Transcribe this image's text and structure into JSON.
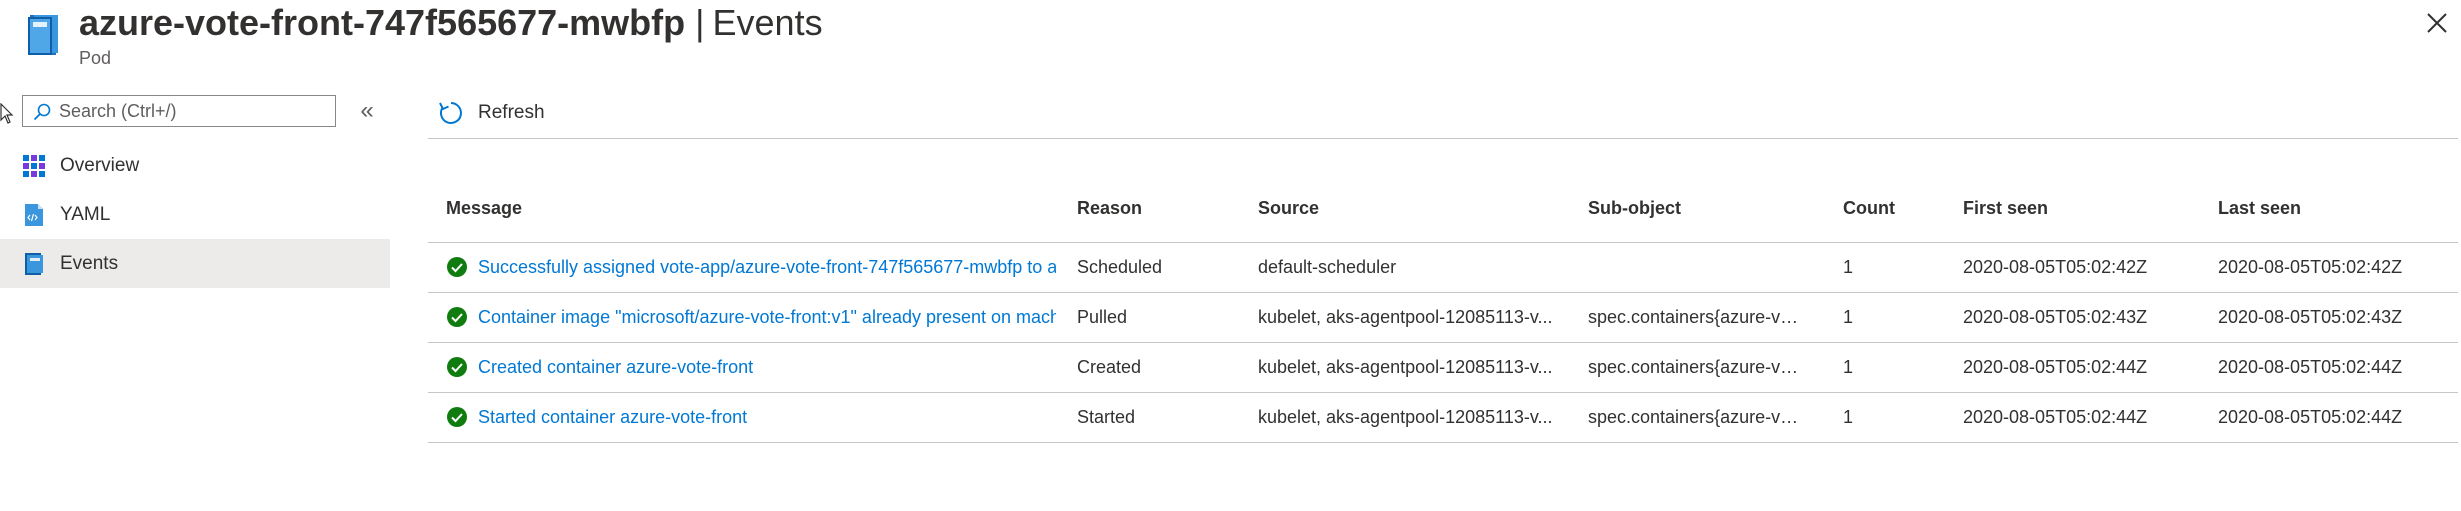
{
  "header": {
    "resource_name": "azure-vote-front-747f565677-mwbfp",
    "separator": "|",
    "section": "Events",
    "resource_type": "Pod"
  },
  "sidebar": {
    "search_placeholder": "Search (Ctrl+/)",
    "search_value": "",
    "collapse_glyph": "«",
    "items": [
      {
        "label": "Overview",
        "icon": "overview-grid-icon",
        "selected": false
      },
      {
        "label": "YAML",
        "icon": "yaml-file-icon",
        "selected": false
      },
      {
        "label": "Events",
        "icon": "events-icon",
        "selected": true
      }
    ]
  },
  "toolbar": {
    "refresh_label": "Refresh"
  },
  "events_table": {
    "columns": [
      "Message",
      "Reason",
      "Source",
      "Sub-object",
      "Count",
      "First seen",
      "Last seen"
    ],
    "rows": [
      {
        "message": "Successfully assigned vote-app/azure-vote-front-747f565677-mwbfp to a",
        "reason": "Scheduled",
        "source": "default-scheduler",
        "subobject": "",
        "count": "1",
        "first_seen": "2020-08-05T05:02:42Z",
        "last_seen": "2020-08-05T05:02:42Z"
      },
      {
        "message": "Container image \"microsoft/azure-vote-front:v1\" already present on mach",
        "reason": "Pulled",
        "source": "kubelet, aks-agentpool-12085113-v...",
        "subobject": "spec.containers{azure-vot...",
        "count": "1",
        "first_seen": "2020-08-05T05:02:43Z",
        "last_seen": "2020-08-05T05:02:43Z"
      },
      {
        "message": "Created container azure-vote-front",
        "reason": "Created",
        "source": "kubelet, aks-agentpool-12085113-v...",
        "subobject": "spec.containers{azure-vot...",
        "count": "1",
        "first_seen": "2020-08-05T05:02:44Z",
        "last_seen": "2020-08-05T05:02:44Z"
      },
      {
        "message": "Started container azure-vote-front",
        "reason": "Started",
        "source": "kubelet, aks-agentpool-12085113-v...",
        "subobject": "spec.containers{azure-vot...",
        "count": "1",
        "first_seen": "2020-08-05T05:02:44Z",
        "last_seen": "2020-08-05T05:02:44Z"
      }
    ]
  },
  "colors": {
    "link": "#0078d4",
    "success": "#107c10",
    "selected_bg": "#edebe9",
    "divider": "#c8c6c4"
  }
}
